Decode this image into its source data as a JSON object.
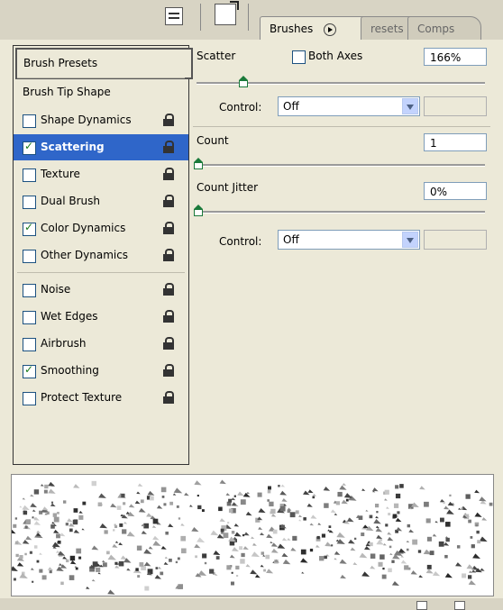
{
  "tabs": [
    {
      "label": "Brushes"
    },
    {
      "label": "resets"
    },
    {
      "label": "Comps"
    }
  ],
  "left_panel": {
    "brush_presets": "Brush Presets",
    "brush_tip_shape": "Brush Tip Shape",
    "options": [
      {
        "label": "Shape Dynamics",
        "checked": false
      },
      {
        "label": "Scattering",
        "checked": true,
        "selected": true
      },
      {
        "label": "Texture",
        "checked": false
      },
      {
        "label": "Dual Brush",
        "checked": false
      },
      {
        "label": "Color Dynamics",
        "checked": true
      },
      {
        "label": "Other Dynamics",
        "checked": false
      },
      {
        "label": "Noise",
        "checked": false
      },
      {
        "label": "Wet Edges",
        "checked": false
      },
      {
        "label": "Airbrush",
        "checked": false
      },
      {
        "label": "Smoothing",
        "checked": true
      },
      {
        "label": "Protect Texture",
        "checked": false
      }
    ]
  },
  "scatter": {
    "label": "Scatter",
    "both_axes_label": "Both Axes",
    "both_axes_checked": false,
    "value": "166%",
    "control_label": "Control:",
    "control_value": "Off"
  },
  "count": {
    "label": "Count",
    "value": "1"
  },
  "count_jitter": {
    "label": "Count Jitter",
    "value": "0%",
    "control_label": "Control:",
    "control_value": "Off"
  },
  "icons": {
    "palette_menu": "palette-menu-icon",
    "new_brush_doc": "brush-document-icon",
    "options_arrow": "play-arrow-icon",
    "lock": "lock-icon",
    "dropdown": "chevron-down-icon",
    "new_preset": "new-preset-icon",
    "trash": "trash-icon"
  },
  "colors": {
    "panel_bg": "#ece9d8",
    "selection": "#2f66c9",
    "check_green": "#1a7a1a",
    "input_border": "#7f9db9"
  }
}
